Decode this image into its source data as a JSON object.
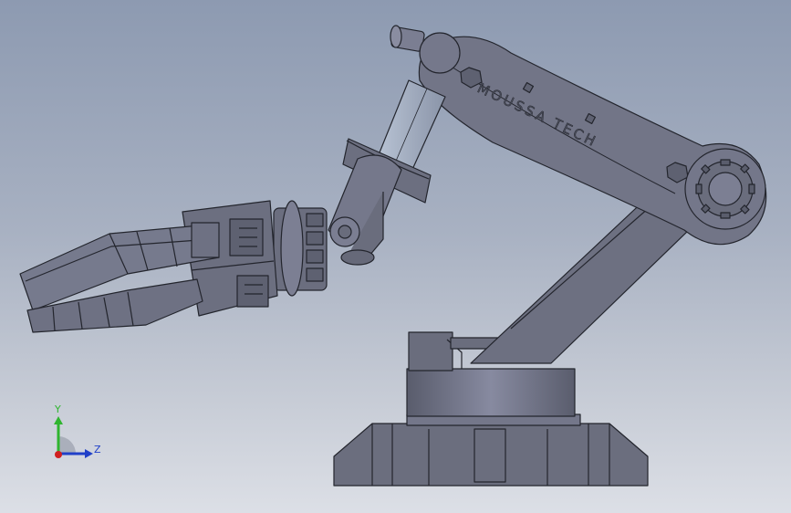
{
  "viewport": {
    "background_top": "#8d9ab1",
    "background_bottom": "#dcdfe6",
    "model_color": "#6b6e7e",
    "edge_color": "#23252d",
    "engraving_text": "MOUSSA TECH"
  },
  "triad": {
    "y_label": "Y",
    "z_label": "Z",
    "y_color": "#2fb52f",
    "z_color": "#2040c8",
    "x_color": "#d02020"
  }
}
